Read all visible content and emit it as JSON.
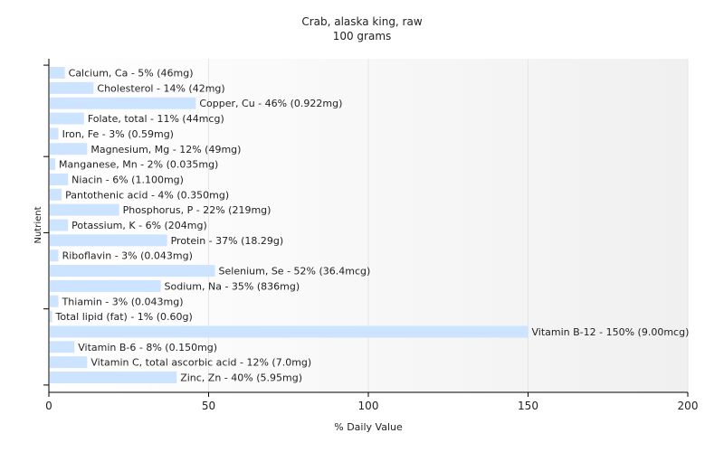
{
  "chart_data": {
    "type": "bar",
    "orientation": "horizontal",
    "title": "Crab, alaska king, raw",
    "subtitle": "100 grams",
    "xlabel": "% Daily Value",
    "ylabel": "Nutrient",
    "xlim": [
      0,
      200
    ],
    "xticks": [
      0,
      50,
      100,
      150,
      200
    ],
    "grid": false,
    "bar_color": "#cce4ff",
    "categories": [
      "Calcium, Ca - 5% (46mg)",
      "Cholesterol - 14% (42mg)",
      "Copper, Cu - 46% (0.922mg)",
      "Folate, total - 11% (44mcg)",
      "Iron, Fe - 3% (0.59mg)",
      "Magnesium, Mg - 12% (49mg)",
      "Manganese, Mn - 2% (0.035mg)",
      "Niacin - 6% (1.100mg)",
      "Pantothenic acid - 4% (0.350mg)",
      "Phosphorus, P - 22% (219mg)",
      "Potassium, K - 6% (204mg)",
      "Protein - 37% (18.29g)",
      "Riboflavin - 3% (0.043mg)",
      "Selenium, Se - 52% (36.4mcg)",
      "Sodium, Na - 35% (836mg)",
      "Thiamin - 3% (0.043mg)",
      "Total lipid (fat) - 1% (0.60g)",
      "Vitamin B-12 - 150% (9.00mcg)",
      "Vitamin B-6 - 8% (0.150mg)",
      "Vitamin C, total ascorbic acid - 12% (7.0mg)",
      "Zinc, Zn - 40% (5.95mg)"
    ],
    "values": [
      5,
      14,
      46,
      11,
      3,
      12,
      2,
      6,
      4,
      22,
      6,
      37,
      3,
      52,
      35,
      3,
      1,
      150,
      8,
      12,
      40
    ]
  }
}
